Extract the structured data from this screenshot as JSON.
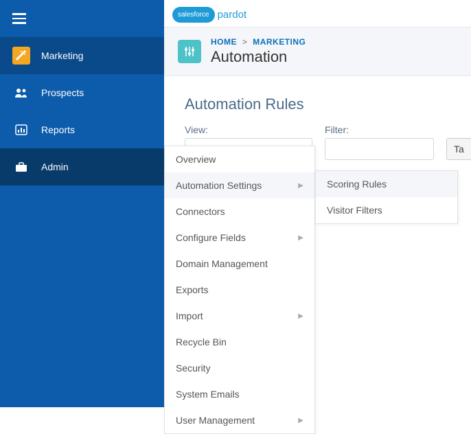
{
  "logo": {
    "cloud": "salesforce",
    "product": "pardot"
  },
  "sidebar": {
    "items": [
      {
        "label": "Marketing"
      },
      {
        "label": "Prospects"
      },
      {
        "label": "Reports"
      },
      {
        "label": "Admin"
      }
    ]
  },
  "breadcrumb": {
    "home": "HOME",
    "sep": ">",
    "section": "MARKETING"
  },
  "page_title": "Automation",
  "section_title": "Automation Rules",
  "filters": {
    "view_label": "View:",
    "filter_label": "Filter:",
    "task_button": "Ta"
  },
  "admin_menu": {
    "items": [
      {
        "label": "Overview",
        "has_submenu": false
      },
      {
        "label": "Automation Settings",
        "has_submenu": true,
        "hover": true
      },
      {
        "label": "Connectors",
        "has_submenu": false
      },
      {
        "label": "Configure Fields",
        "has_submenu": true
      },
      {
        "label": "Domain Management",
        "has_submenu": false
      },
      {
        "label": "Exports",
        "has_submenu": false
      },
      {
        "label": "Import",
        "has_submenu": true
      },
      {
        "label": "Recycle Bin",
        "has_submenu": false
      },
      {
        "label": "Security",
        "has_submenu": false
      },
      {
        "label": "System Emails",
        "has_submenu": false
      },
      {
        "label": "User Management",
        "has_submenu": true
      }
    ]
  },
  "automation_submenu": {
    "items": [
      {
        "label": "Scoring Rules",
        "hover": true
      },
      {
        "label": "Visitor Filters"
      }
    ]
  }
}
